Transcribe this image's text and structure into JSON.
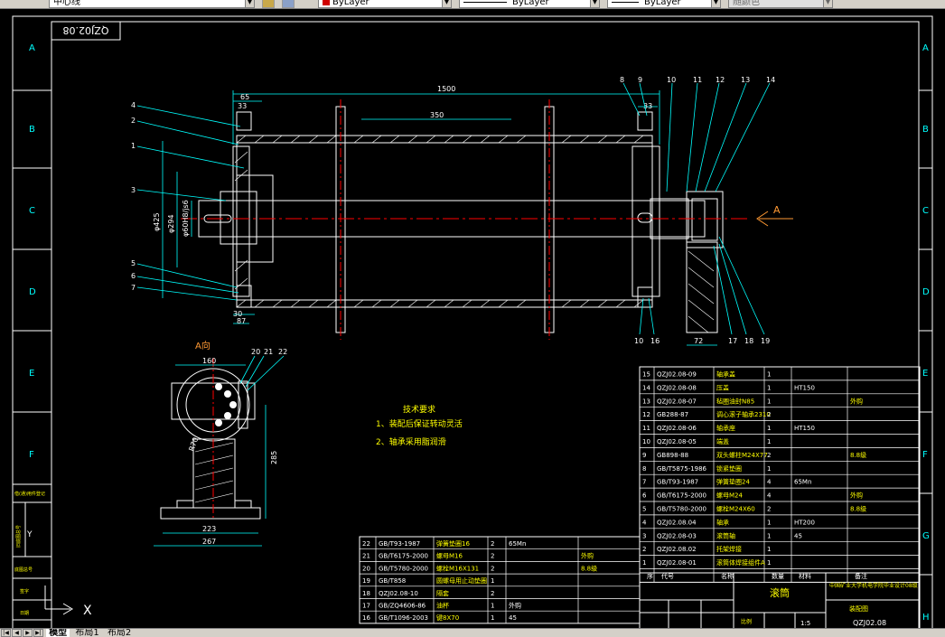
{
  "toolbar": {
    "linetype_combo": "中心线",
    "linetype_combo_id": "2",
    "color_combo": "ByLayer",
    "linetype_combo2": "ByLayer",
    "lineweight_combo": "ByLayer",
    "plotstyle_combo": "随颜色"
  },
  "drawing": {
    "drawing_number": "QZJ02.08",
    "border_letters": [
      "A",
      "B",
      "C",
      "D",
      "E",
      "F",
      "G",
      "H"
    ],
    "dims": {
      "len_1500": "1500",
      "len_350": "350",
      "len_65": "65",
      "len_33": "33",
      "len_33r": "33",
      "dia_425": "φ425",
      "dia_294": "φ294",
      "dia_60": "φ60H8/js6",
      "len_87": "87",
      "len_30": "30",
      "len_72": "72",
      "len_160": "160",
      "len_285": "285",
      "len_223": "223",
      "len_267": "267",
      "r_rad": "R70"
    },
    "view_label_a": "A",
    "view_title_a": "A向",
    "callouts_left": [
      "4",
      "2",
      "1",
      "3",
      "5",
      "6",
      "7"
    ],
    "callouts_top": [
      "8",
      "9",
      "10",
      "11",
      "12",
      "13",
      "14"
    ],
    "callouts_bottom": [
      "10",
      "16",
      "17",
      "18",
      "19"
    ],
    "callouts_section": [
      "20",
      "21",
      "22"
    ],
    "tech_req": {
      "title": "技术要求",
      "items": [
        "1、装配后保证转动灵活",
        "2、轴承采用脂润滑"
      ]
    }
  },
  "parts_table": {
    "rows": [
      {
        "no": "15",
        "code": "QZJ02.08-09",
        "name": "轴承盖",
        "qty": "1",
        "mat": "",
        "note": ""
      },
      {
        "no": "14",
        "code": "QZJ02.08-08",
        "name": "压盖",
        "qty": "1",
        "mat": "HT150",
        "note": ""
      },
      {
        "no": "13",
        "code": "QZJ02.08-07",
        "name": "毡圈油封N85",
        "qty": "1",
        "mat": "",
        "note": "外购"
      },
      {
        "no": "12",
        "code": "GB288-87",
        "name": "调心滚子轴承2310",
        "qty": "2",
        "mat": "",
        "note": ""
      },
      {
        "no": "11",
        "code": "QZJ02.08-06",
        "name": "轴承座",
        "qty": "1",
        "mat": "HT150",
        "note": ""
      },
      {
        "no": "10",
        "code": "QZJ02.08-05",
        "name": "端盖",
        "qty": "1",
        "mat": "",
        "note": ""
      },
      {
        "no": "9",
        "code": "GB898-88",
        "name": "双头螺柱M24X77",
        "qty": "2",
        "mat": "",
        "note": "8.8级"
      },
      {
        "no": "8",
        "code": "GB/T5875-1986",
        "name": "锁紧垫圈",
        "qty": "1",
        "mat": "",
        "note": ""
      },
      {
        "no": "7",
        "code": "GB/T93-1987",
        "name": "弹簧垫圈24",
        "qty": "4",
        "mat": "65Mn",
        "note": ""
      },
      {
        "no": "6",
        "code": "GB/T6175-2000",
        "name": "螺母M24",
        "qty": "4",
        "mat": "",
        "note": "外购"
      },
      {
        "no": "5",
        "code": "GB/T5780-2000",
        "name": "螺栓M24X60",
        "qty": "2",
        "mat": "",
        "note": "8.8级"
      },
      {
        "no": "4",
        "code": "QZJ02.08.04",
        "name": "轴承",
        "qty": "1",
        "mat": "HT200",
        "note": ""
      },
      {
        "no": "3",
        "code": "QZJ02.08-03",
        "name": "滚筒轴",
        "qty": "1",
        "mat": "45",
        "note": ""
      },
      {
        "no": "2",
        "code": "QZJ02.08.02",
        "name": "托架焊接",
        "qty": "1",
        "mat": "",
        "note": ""
      },
      {
        "no": "1",
        "code": "QZJ02.08-01",
        "name": "滚筒体焊接组件A",
        "qty": "1",
        "mat": "",
        "note": ""
      }
    ],
    "header": {
      "no": "序",
      "code": "代号",
      "name": "名称",
      "qty": "数量",
      "mat": "材料",
      "note": "备注"
    }
  },
  "parts_table_lower": {
    "rows": [
      {
        "no": "22",
        "code": "GB/T93-1987",
        "name": "弹簧垫圈16",
        "qty": "2",
        "mat": "65Mn",
        "note": ""
      },
      {
        "no": "21",
        "code": "GB/T6175-2000",
        "name": "螺母M16",
        "qty": "2",
        "mat": "",
        "note": "外购"
      },
      {
        "no": "20",
        "code": "GB/T5780-2000",
        "name": "螺栓M16X131",
        "qty": "2",
        "mat": "",
        "note": "8.8级"
      },
      {
        "no": "19",
        "code": "GB/T858",
        "name": "圆螺母用止动垫圈",
        "qty": "1",
        "mat": "",
        "note": ""
      },
      {
        "no": "18",
        "code": "QZJ02.08-10",
        "name": "隔套",
        "qty": "2",
        "mat": "",
        "note": ""
      },
      {
        "no": "17",
        "code": "GB/ZQ4606-86",
        "name": "油杯",
        "qty": "1",
        "mat": "外购",
        "note": ""
      },
      {
        "no": "16",
        "code": "GB/T1096-2003",
        "name": "键8X70",
        "qty": "1",
        "mat": "45",
        "note": ""
      }
    ]
  },
  "title_block": {
    "drawing_name": "滚筒",
    "company": "中国矿业大学机电学院毕业设计08级",
    "drawing_no": "QZJ02.08",
    "assembly": "装配图",
    "scale_label": "比例",
    "scale": "1:5"
  },
  "side_labels": [
    "借(通)用件登记",
    "旧底图总号",
    "底图总号",
    "签字",
    "日期"
  ],
  "ucs": {
    "x": "X",
    "y": "Y"
  },
  "tabs": [
    "模型",
    "布局1",
    "布局2"
  ],
  "colors": {
    "bg": "#000000",
    "cyan": "#00ffff",
    "white": "#ffffff",
    "red": "#ff0000",
    "yellow": "#ffff00",
    "orange": "#ff9933",
    "green": "#00ff00"
  }
}
